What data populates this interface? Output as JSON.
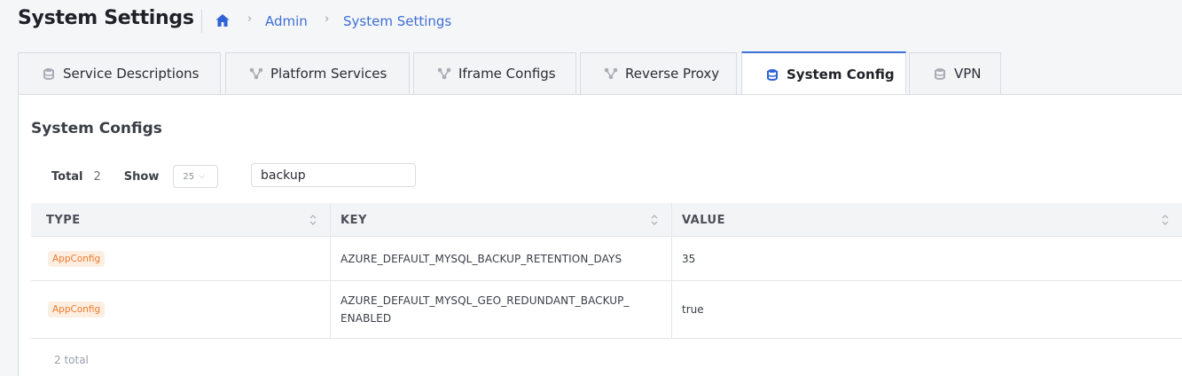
{
  "header": {
    "title": "System Settings",
    "breadcrumb": [
      "Admin",
      "System Settings"
    ]
  },
  "tabs": [
    {
      "label": "Service Descriptions",
      "icon": "database-icon"
    },
    {
      "label": "Platform Services",
      "icon": "network-icon"
    },
    {
      "label": "Iframe Configs",
      "icon": "network-icon"
    },
    {
      "label": "Reverse Proxy",
      "icon": "network-icon"
    },
    {
      "label": "System Config",
      "icon": "database-icon",
      "active": true
    },
    {
      "label": "VPN",
      "icon": "database-icon"
    }
  ],
  "panel": {
    "title": "System Configs",
    "total_label": "Total",
    "total_value": "2",
    "show_label": "Show",
    "page_size": "25",
    "search_value": "backup"
  },
  "table": {
    "columns": [
      "TYPE",
      "KEY",
      "VALUE"
    ],
    "rows": [
      {
        "type": "AppConfig",
        "key": "AZURE_DEFAULT_MYSQL_BACKUP_RETENTION_DAYS",
        "value": "35"
      },
      {
        "type": "AppConfig",
        "key_line1": "AZURE_DEFAULT_MYSQL_GEO_REDUNDANT_BACKUP_",
        "key_line2": "ENABLED",
        "value": "true"
      }
    ],
    "footer": "2 total"
  },
  "colors": {
    "accent": "#3d6fd6",
    "badge_text": "#ee7b2c",
    "badge_bg": "#fdeee2"
  }
}
